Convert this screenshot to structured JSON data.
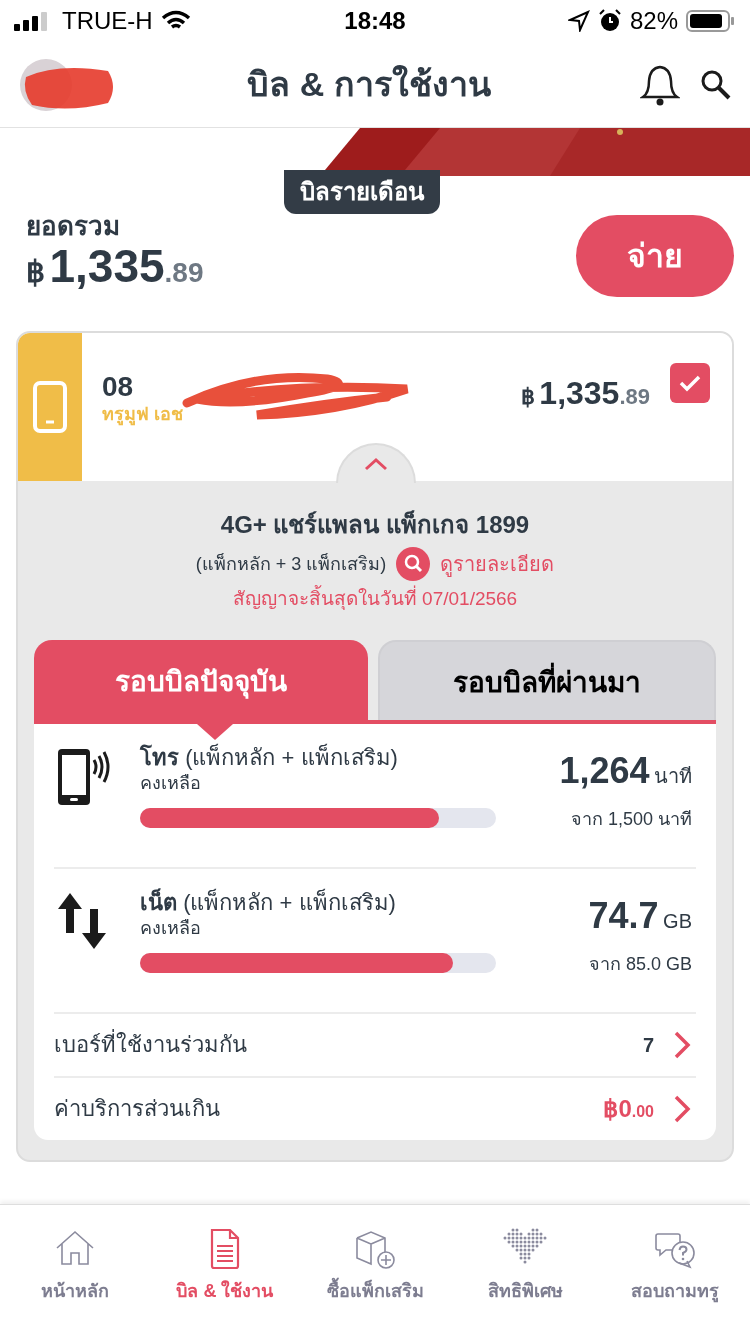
{
  "status_bar": {
    "carrier": "TRUE-H",
    "time": "18:48",
    "battery": "82%"
  },
  "header": {
    "title": "บิล & การใช้งาน"
  },
  "bill_tag": "บิลรายเดือน",
  "total": {
    "label": "ยอดรวม",
    "currency": "฿",
    "amount": "1,335",
    "decimals": ".89",
    "pay_button": "จ่าย"
  },
  "account": {
    "number": "08",
    "operator": "ทรูมูฟ เอช",
    "currency": "฿",
    "amount": "1,335",
    "decimals": ".89",
    "checked": true,
    "expanded": true
  },
  "package": {
    "name": "4G+ แชร์แพลน แพ็กเกจ 1899",
    "addons": "(แพ็กหลัก + 3 แพ็กเสริม)",
    "details_link": "ดูรายละเอียด",
    "contract": "สัญญาจะสิ้นสุดในวันที่ 07/01/2566"
  },
  "tabs": [
    {
      "label": "รอบบิลปัจจุบัน",
      "selected": true
    },
    {
      "label": "รอบบิลที่ผ่านมา",
      "selected": false
    }
  ],
  "usage": [
    {
      "kind": "call",
      "title": "โทร",
      "subtitle": "(แพ็กหลัก + แพ็กเสริม)",
      "remaining_label": "คงเหลือ",
      "value": "1,264",
      "unit": "นาที",
      "total": "จาก 1,500 นาที",
      "level": 0.84
    },
    {
      "kind": "data",
      "title": "เน็ต",
      "subtitle": "(แพ็กหลัก + แพ็กเสริม)",
      "remaining_label": "คงเหลือ",
      "value": "74.7",
      "unit": "GB",
      "total": "จาก 85.0 GB",
      "level": 0.88
    }
  ],
  "links": [
    {
      "kind": "count",
      "label": "เบอร์ที่ใช้งานร่วมกัน",
      "value": "7"
    },
    {
      "kind": "money",
      "label": "ค่าบริการส่วนเกิน",
      "currency": "฿",
      "value": "0",
      "decimals": ".00"
    }
  ],
  "nav": [
    {
      "kind": "home",
      "label": "หน้าหลัก",
      "selected": false
    },
    {
      "kind": "bill",
      "label": "บิล & ใช้งาน",
      "selected": true
    },
    {
      "kind": "package",
      "label": "ซื้อแพ็กเสริม",
      "selected": false
    },
    {
      "kind": "privilege",
      "label": "สิทธิพิเศษ",
      "selected": false
    },
    {
      "kind": "help",
      "label": "สอบถามทรู",
      "selected": false
    }
  ]
}
